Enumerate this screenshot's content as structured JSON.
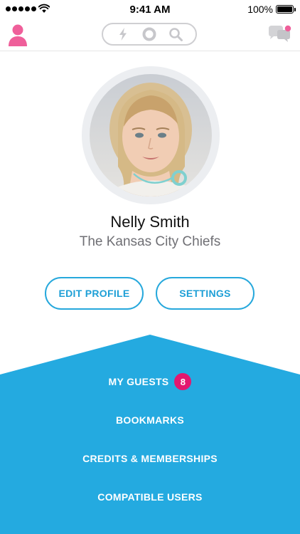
{
  "status_bar": {
    "time": "9:41 AM",
    "battery_percent": "100%",
    "signal_icon": "cellular-signal-icon",
    "wifi_icon": "wifi-icon",
    "battery_icon": "battery-icon"
  },
  "nav": {
    "left_icon": "user-profile-icon",
    "segment_icons": [
      "lightning-icon",
      "circle-icon",
      "search-icon"
    ],
    "right_icon": "chat-bubbles-icon",
    "accent_color": "#ef5f9a"
  },
  "profile": {
    "name": "Nelly Smith",
    "team": "The Kansas City Chiefs",
    "avatar": "profile-photo"
  },
  "actions": {
    "edit_profile": "EDIT PROFILE",
    "settings": "SETTINGS"
  },
  "menu": {
    "items": [
      {
        "label": "MY GUESTS",
        "badge": "8"
      },
      {
        "label": "BOOKMARKS"
      },
      {
        "label": "CREDITS & MEMBERSHIPS"
      },
      {
        "label": "COMPATIBLE USERS"
      }
    ],
    "background_color": "#24aae0",
    "badge_color": "#e3176f"
  },
  "colors": {
    "primary_blue": "#26a8dc",
    "text_gray": "#6f6f74"
  }
}
